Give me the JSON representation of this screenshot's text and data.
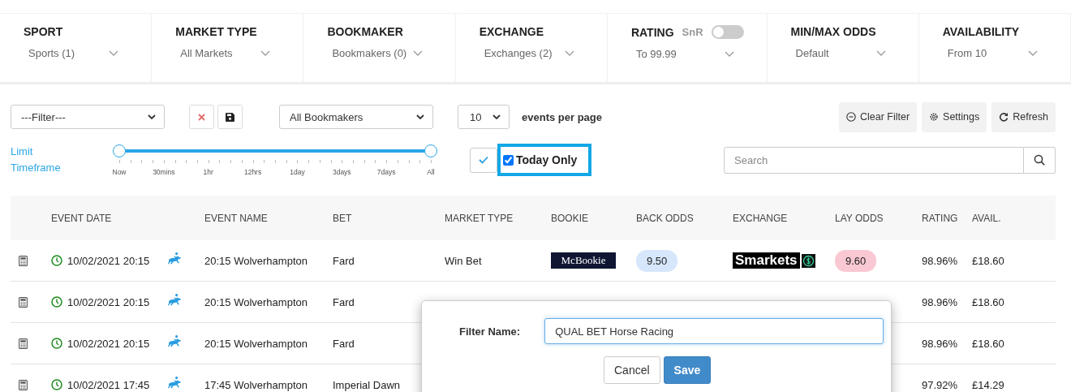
{
  "filters": [
    {
      "label": "SPORT",
      "value": "Sports (1)"
    },
    {
      "label": "MARKET TYPE",
      "value": "All Markets"
    },
    {
      "label": "BOOKMAKER",
      "value": "Bookmakers (0)"
    },
    {
      "label": "EXCHANGE",
      "value": "Exchanges (2)"
    },
    {
      "label": "RATING",
      "value": "To 99.99",
      "toggle": {
        "label": "SnR",
        "on": false
      }
    },
    {
      "label": "MIN/MAX ODDS",
      "value": "Default"
    },
    {
      "label": "AVAILABILITY",
      "value": "From 10"
    }
  ],
  "toolbar": {
    "filter_select": "---Filter---",
    "bookmaker_select": "All Bookmakers",
    "per_page": "10",
    "per_page_label": "events per page",
    "buttons": [
      {
        "kind": "clear",
        "label": "Clear Filter"
      },
      {
        "kind": "settings",
        "label": "Settings"
      },
      {
        "kind": "refresh",
        "label": "Refresh"
      }
    ]
  },
  "timeframe": {
    "label": "Limit Timeframe",
    "thumbs": [
      {
        "level": 0
      },
      {
        "level": 1
      }
    ],
    "ticks": [
      "Now",
      "30mins",
      "1hr",
      "12hrs",
      "1day",
      "3days",
      "7days",
      "All"
    ]
  },
  "today_only": {
    "label": "Today Only",
    "checked": true,
    "highlighted": true
  },
  "search": {
    "placeholder": "Search"
  },
  "table": {
    "columns": [
      "EVENT DATE",
      "EVENT NAME",
      "BET",
      "MARKET TYPE",
      "BOOKIE",
      "BACK ODDS",
      "EXCHANGE",
      "LAY ODDS",
      "RATING",
      "AVAIL."
    ],
    "rows": [
      {
        "date": "10/02/2021 20:15",
        "event": "20:15 Wolverhampton",
        "bet": "Fard",
        "market_type": "Win Bet",
        "bookie": "McBookie",
        "back_odds": "9.50",
        "exchange": "Smarkets",
        "lay_odds": "9.60",
        "rating": "98.96%",
        "avail": "£18.60"
      },
      {
        "date": "10/02/2021 20:15",
        "event": "20:15 Wolverhampton",
        "bet": "Fard",
        "rating": "98.96%",
        "avail": "£18.60"
      },
      {
        "date": "10/02/2021 20:15",
        "event": "20:15 Wolverhampton",
        "bet": "Fard",
        "rating": "98.96%",
        "avail": "£18.60"
      },
      {
        "date": "10/02/2021 17:45",
        "event": "17:45 Wolverhampton",
        "bet": "Imperial Dawn",
        "rating": "97.92%",
        "avail": "£14.29"
      }
    ]
  },
  "dialog": {
    "label": "Filter Name:",
    "value": "QUAL BET Horse Racing",
    "buttons": [
      {
        "kind": "cancel",
        "label": "Cancel"
      },
      {
        "kind": "save",
        "label": "Save"
      }
    ]
  }
}
